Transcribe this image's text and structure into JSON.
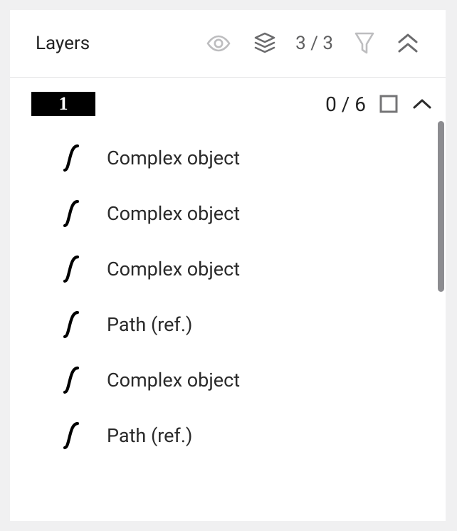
{
  "header": {
    "title": "Layers",
    "visible_count": "3 / 3"
  },
  "group": {
    "badge": "1",
    "selected_count": "0 / 6",
    "children": [
      {
        "label": "Complex object"
      },
      {
        "label": "Complex object"
      },
      {
        "label": "Complex object"
      },
      {
        "label": "Path (ref.)"
      },
      {
        "label": "Complex object"
      },
      {
        "label": "Path (ref.)"
      }
    ]
  }
}
